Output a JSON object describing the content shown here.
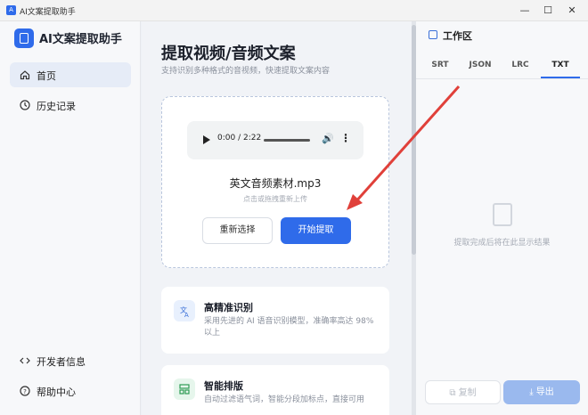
{
  "window": {
    "title": "AI文案提取助手",
    "minimize": "—",
    "maximize": "☐",
    "close": "✕"
  },
  "sidebar": {
    "brand": "AI文案提取助手",
    "nav": [
      {
        "label": "首页",
        "icon": "home-icon",
        "active": true
      },
      {
        "label": "历史记录",
        "icon": "clock-icon",
        "active": false
      }
    ],
    "bottom": [
      {
        "label": "开发者信息",
        "icon": "code-icon"
      },
      {
        "label": "帮助中心",
        "icon": "help-icon"
      }
    ]
  },
  "main": {
    "title": "提取视频/音频文案",
    "subtitle": "支持识别多种格式的音视频，快速提取文案内容",
    "player": {
      "time": "0:00 / 2:22"
    },
    "file_name": "英文音频素材.mp3",
    "upload_hint": "点击或拖拽重新上传",
    "reselect_label": "重新选择",
    "extract_label": "开始提取",
    "features": [
      {
        "title": "高精准识别",
        "desc": "采用先进的 AI 语音识别模型，准确率高达 98% 以上",
        "icon": "translate-icon",
        "color": "#e8f0fd"
      },
      {
        "title": "智能排版",
        "desc": "自动过滤语气词，智能分段加标点，直接可用",
        "icon": "layout-icon",
        "color": "#e6f6ec"
      }
    ]
  },
  "workspace": {
    "title": "工作区",
    "tabs": [
      {
        "label": "SRT",
        "active": false
      },
      {
        "label": "JSON",
        "active": false
      },
      {
        "label": "LRC",
        "active": false
      },
      {
        "label": "TXT",
        "active": true
      }
    ],
    "empty_text": "提取完成后将在此显示结果",
    "copy_label": "复制",
    "export_label": "导出"
  },
  "colors": {
    "accent": "#2f6bea",
    "annotation_arrow": "#e0403a"
  }
}
